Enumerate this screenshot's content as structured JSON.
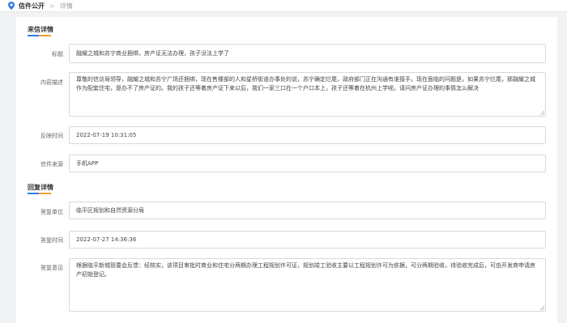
{
  "breadcrumb": {
    "icon": "location-pin-icon",
    "section": "信件公开",
    "separator": ">",
    "current": "详情"
  },
  "letter": {
    "section_title": "来信详情",
    "title_label": "标题",
    "title_value": "融耀之城和苏宁商业捆绑，房产证无法办理，孩子没法上学了",
    "content_label": "内容描述",
    "content_value": "尊敬的信访局领导，融耀之城和苏宁广场还捆绑，现在售楼部的人和星桥街道办事处的说，苏宁确定烂尾，政府部门正在沟通有谁接手。现在面临的问题是，如果苏宁烂尾，那融耀之城作为配套住宅，是办不了房产证的。我的孩子还等着房产证下来以后，我们一家三口在一个户口本上，孩子还等着在杭州上学呢。请问房产证办理的事情怎么解决",
    "time_label": "反映时间",
    "time_value": "2022-07-19 10:31:05",
    "source_label": "信件来源",
    "source_value": "手机APP"
  },
  "reply": {
    "section_title": "回复详情",
    "unit_label": "答复单位",
    "unit_value": "临平区规划和自然资源分局",
    "time_label": "答复时间",
    "time_value": "2022-07-27 14:36:36",
    "opinion_label": "答复意见",
    "opinion_value": "根据临平新城管委会反馈：经核实，该项目审批时商业和住宅分两期办理工程规划许可证，规划竣工验收主要以工程规划许可为依据，可分两期验收，待验收完成后，可由开发商申请房产初始登记。"
  },
  "colors": {
    "accent_blue": "#2f7be9",
    "accent_orange": "#f0a02d",
    "page_bg": "#f0f2f5"
  }
}
